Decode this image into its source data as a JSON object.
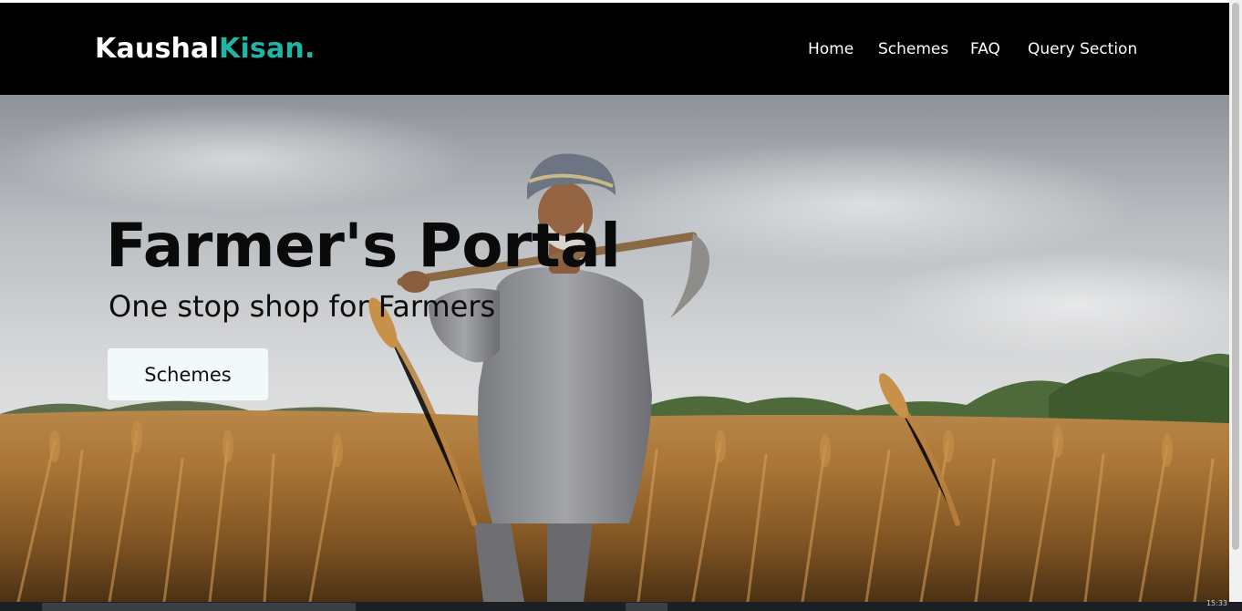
{
  "brand": {
    "name_primary": "Kaushal",
    "name_accent": "Kisan."
  },
  "nav": {
    "items": [
      {
        "label": "Home"
      },
      {
        "label": "Schemes"
      },
      {
        "label": "FAQ"
      },
      {
        "label": "Query Section"
      }
    ]
  },
  "hero": {
    "title": "Farmer's Portal",
    "subtitle": "One stop shop for Farmers",
    "button_label": "Schemes"
  },
  "taskbar": {
    "clock": "15:33"
  },
  "colors": {
    "navbar_bg": "#000000",
    "brand_accent": "#1fb5a6",
    "button_bg": "#f1f9fa"
  },
  "icons": [
    "farmer-wheat-field-photo"
  ]
}
